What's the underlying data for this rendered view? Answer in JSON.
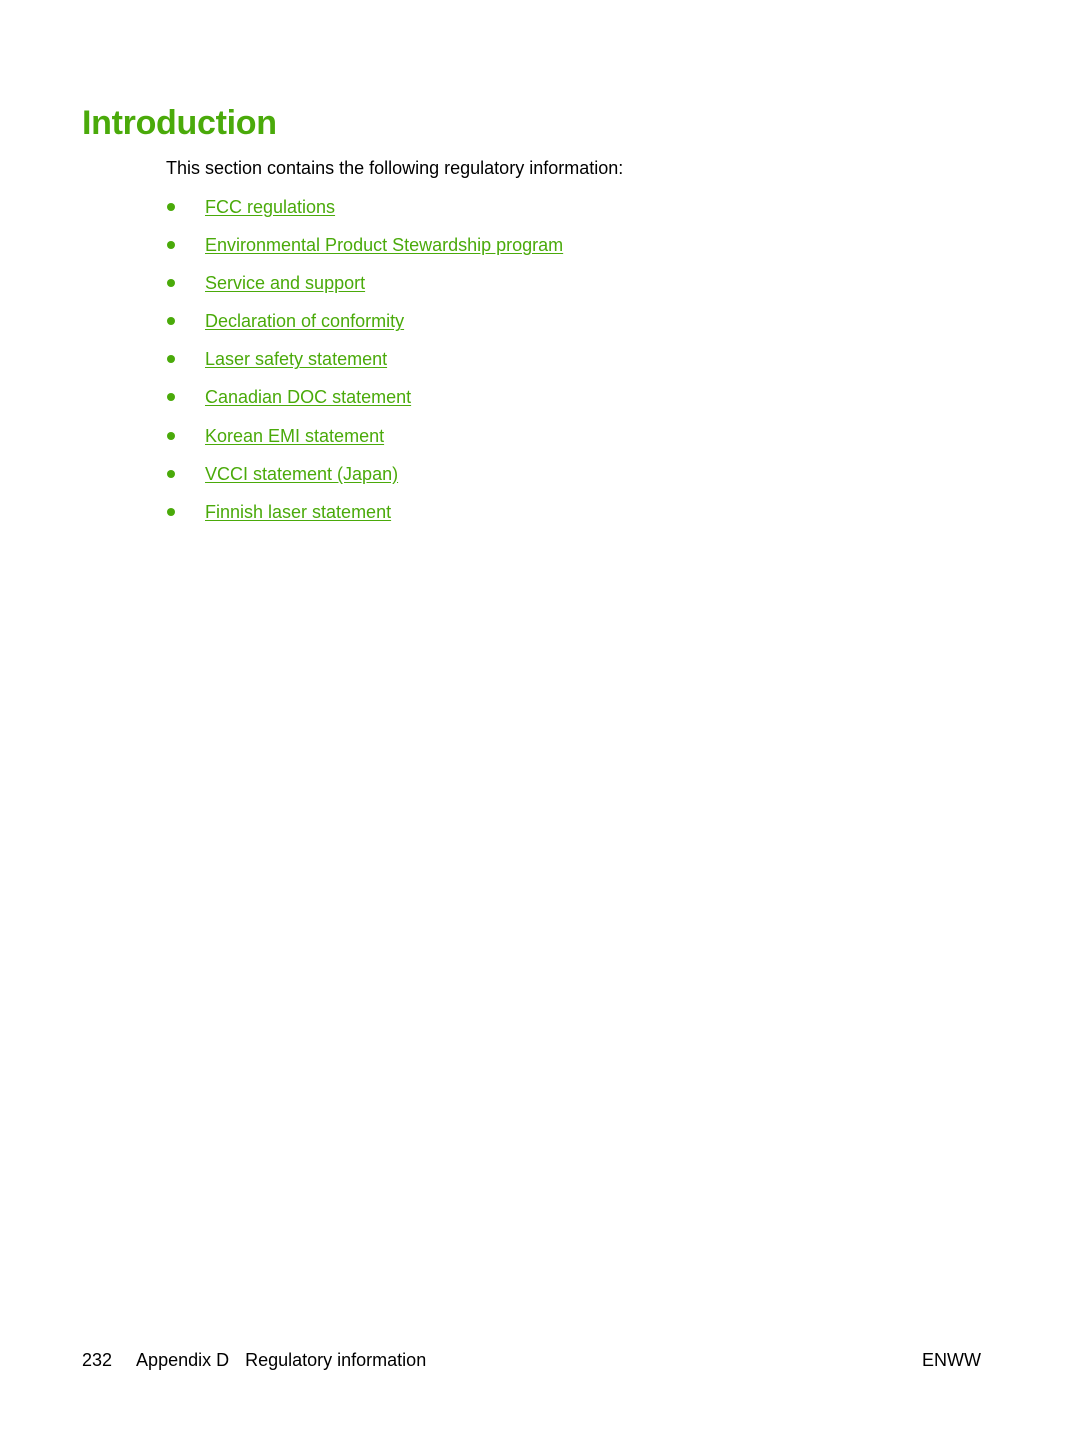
{
  "page": {
    "title": "Introduction",
    "intro": "This section contains the following regulatory information:",
    "links": [
      {
        "label": "FCC regulations"
      },
      {
        "label": "Environmental Product Stewardship program"
      },
      {
        "label": "Service and support"
      },
      {
        "label": "Declaration of conformity"
      },
      {
        "label": "Laser safety statement"
      },
      {
        "label": "Canadian DOC statement"
      },
      {
        "label": "Korean EMI statement"
      },
      {
        "label": "VCCI statement (Japan)"
      },
      {
        "label": "Finnish laser statement"
      }
    ],
    "accent_color": "#4aaa0a"
  },
  "footer": {
    "page_number": "232",
    "chapter": "Appendix D",
    "section": "Regulatory information",
    "locale": "ENWW"
  }
}
